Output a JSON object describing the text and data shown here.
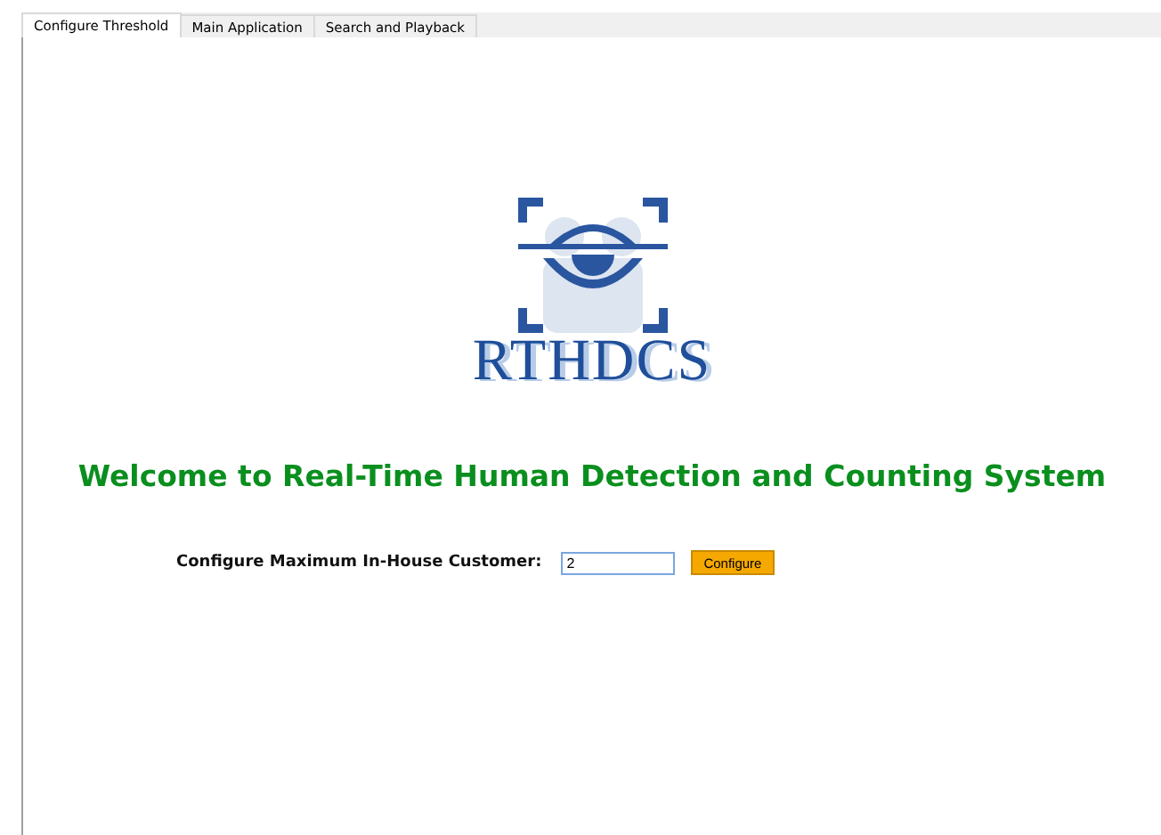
{
  "tabs": [
    {
      "label": "Configure Threshold",
      "selected": true
    },
    {
      "label": "Main Application",
      "selected": false
    },
    {
      "label": "Search and Playback",
      "selected": false
    }
  ],
  "logo": {
    "text": "RTHDCS"
  },
  "heading": "Welcome to Real-Time Human Detection and Counting System",
  "form": {
    "label": "Configure Maximum In-House Customer:",
    "value": "2",
    "button": "Configure"
  }
}
